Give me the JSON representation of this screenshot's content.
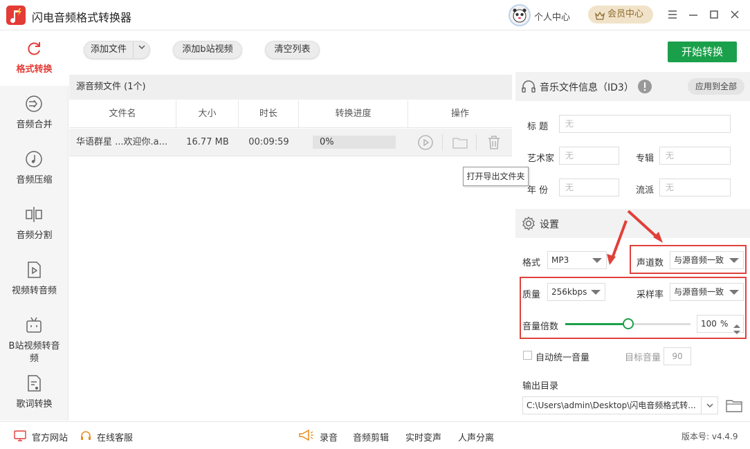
{
  "app": {
    "title": "闪电音频格式转换器"
  },
  "header": {
    "user_center": "个人中心",
    "vip": "会员中心"
  },
  "sidebar": {
    "items": [
      {
        "label": "格式转换"
      },
      {
        "label": "音频合并"
      },
      {
        "label": "音频压缩"
      },
      {
        "label": "音频分割"
      },
      {
        "label": "视频转音频"
      },
      {
        "label": "B站视频转音频"
      },
      {
        "label": "歌词转换"
      }
    ]
  },
  "toolbar": {
    "add_file": "添加文件",
    "add_bili": "添加b站视频",
    "clear_list": "清空列表",
    "start": "开始转换"
  },
  "filelist": {
    "header": "源音频文件 (1个)",
    "columns": [
      "文件名",
      "大小",
      "时长",
      "转换进度",
      "操作"
    ],
    "rows": [
      {
        "name": "华语群星 ...欢迎你.a...",
        "size": "16.77 MB",
        "duration": "00:09:59",
        "progress": "0%",
        "progress_value": 0
      }
    ],
    "tooltip": "打开导出文件夹"
  },
  "id3": {
    "title": "音乐文件信息（ID3）",
    "apply_all": "应用到全部",
    "labels": {
      "title": "标  题",
      "artist": "艺术家",
      "album": "专辑",
      "year": "年  份",
      "genre": "流派"
    },
    "placeholder": "无"
  },
  "settings": {
    "title": "设置",
    "format_label": "格式",
    "format_value": "MP3",
    "channels_label": "声道数",
    "channels_value": "与源音频一致",
    "quality_label": "质量",
    "quality_value": "256kbps",
    "samplerate_label": "采样率",
    "samplerate_value": "与源音频一致",
    "volume_label": "音量倍数",
    "volume_value": "100",
    "volume_unit": "%",
    "volume_level_fraction": 0.5,
    "auto_volume_label": "自动统一音量",
    "auto_volume_checked": false,
    "target_volume_label": "目标音量",
    "target_volume_value": "90",
    "output_label": "输出目录",
    "output_path": "C:\\Users\\admin\\Desktop\\闪电音频格式转..."
  },
  "footer": {
    "official_site": "官方网站",
    "online_service": "在线客服",
    "record": "录音",
    "audio_edit": "音频剪辑",
    "voice_change": "实时变声",
    "vocal_split": "人声分离",
    "version": "版本号: v4.4.9"
  },
  "colors": {
    "brand_red": "#e33b36",
    "accent_green": "#1aa04a",
    "highlight_red": "#e0403a",
    "vip_gold": "#f1e3c9"
  }
}
